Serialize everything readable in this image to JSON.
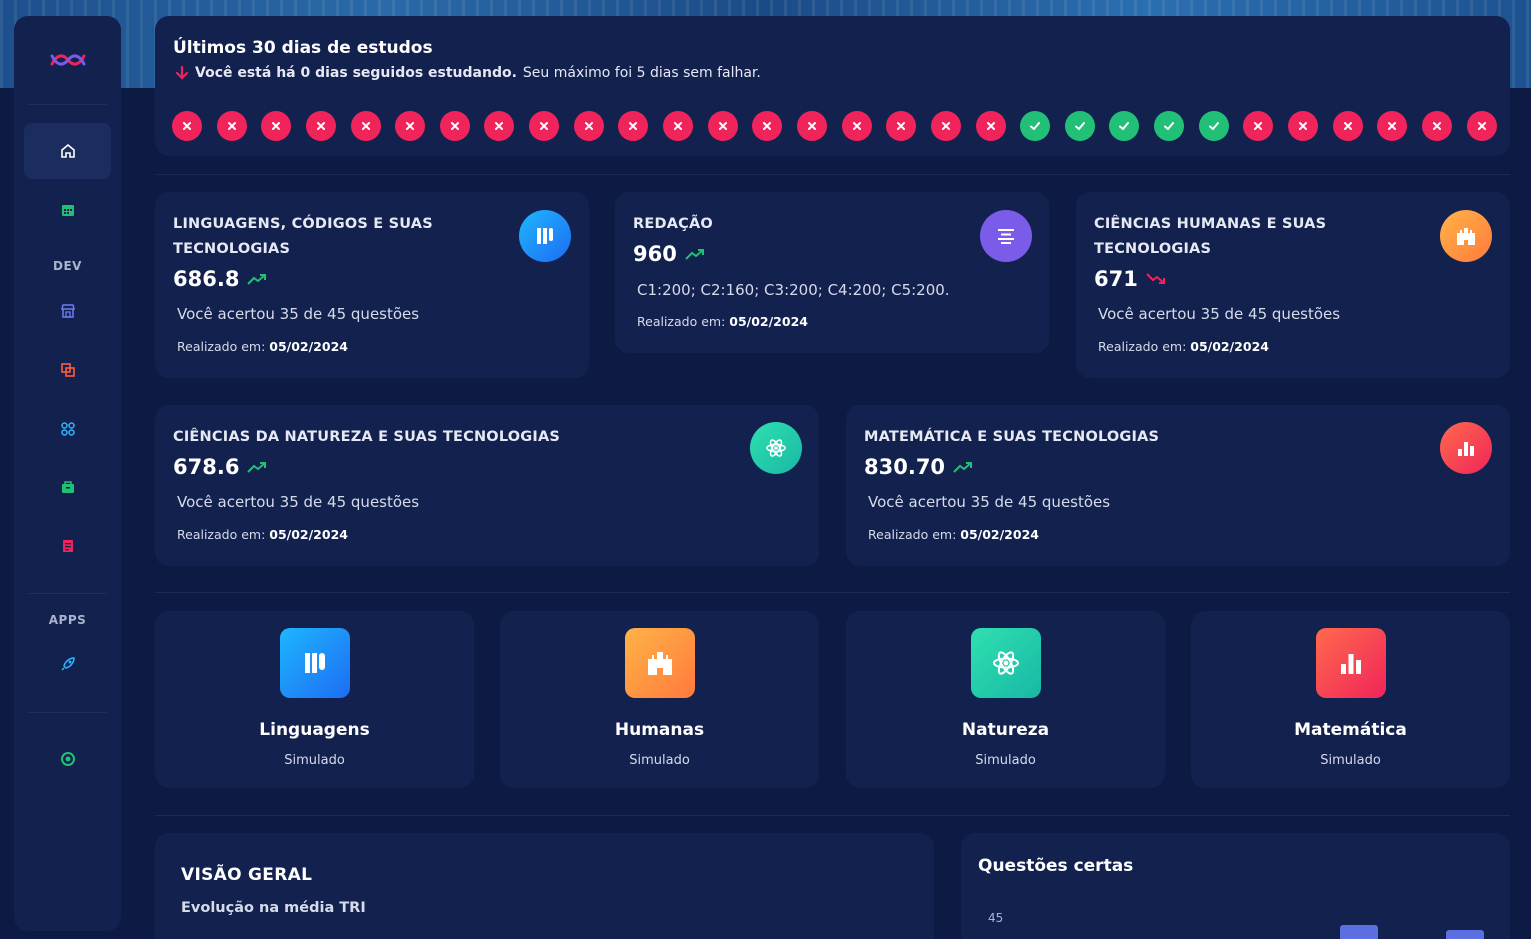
{
  "sidebar": {
    "sections": [
      "DEV",
      "APPS"
    ],
    "items": [
      {
        "icon": "home-icon",
        "active": true
      },
      {
        "icon": "calendar-icon"
      },
      {
        "icon": "store-icon"
      },
      {
        "icon": "copy-icon"
      },
      {
        "icon": "command-icon"
      },
      {
        "icon": "bag-icon"
      },
      {
        "icon": "notes-icon"
      },
      {
        "icon": "rocket-icon"
      },
      {
        "icon": "support-icon"
      }
    ]
  },
  "streak": {
    "title": "Últimos 30 dias de estudos",
    "bold_text": "Você está há 0 dias seguidos estudando.",
    "rest_text": "Seu máximo foi 5 dias sem falhar.",
    "days": [
      "miss",
      "miss",
      "miss",
      "miss",
      "miss",
      "miss",
      "miss",
      "miss",
      "miss",
      "miss",
      "miss",
      "miss",
      "miss",
      "miss",
      "miss",
      "miss",
      "miss",
      "miss",
      "miss",
      "hit",
      "hit",
      "hit",
      "hit",
      "hit",
      "miss",
      "miss",
      "miss",
      "miss",
      "miss",
      "miss"
    ]
  },
  "scores": [
    {
      "title": "LINGUAGENS, CÓDIGOS E SUAS TECNOLOGIAS",
      "score": "686.8",
      "trend": "up",
      "detail": "Você acertou 35 de 45 questões",
      "date_label": "Realizado em:",
      "date": "05/02/2024",
      "icon": "books-icon"
    },
    {
      "title": "REDAÇÃO",
      "score": "960",
      "trend": "up",
      "detail": "C1:200; C2:160; C3:200; C4:200; C5:200.",
      "date_label": "Realizado em:",
      "date": "05/02/2024",
      "icon": "align-center-icon"
    },
    {
      "title": "CIÊNCIAS HUMANAS E SUAS TECNOLOGIAS",
      "score": "671",
      "trend": "down",
      "detail": "Você acertou 35 de 45 questões",
      "date_label": "Realizado em:",
      "date": "05/02/2024",
      "icon": "castle-icon"
    },
    {
      "title": "CIÊNCIAS DA NATUREZA E SUAS TECNOLOGIAS",
      "score": "678.6",
      "trend": "up",
      "detail": "Você acertou 35 de 45 questões",
      "date_label": "Realizado em:",
      "date": "05/02/2024",
      "icon": "atom-icon"
    },
    {
      "title": "MATEMÁTICA E SUAS TECNOLOGIAS",
      "score": "830.70",
      "trend": "up",
      "detail": "Você acertou 35 de 45 questões",
      "date_label": "Realizado em:",
      "date": "05/02/2024",
      "icon": "bar-chart-icon"
    }
  ],
  "simulados": [
    {
      "name": "Linguagens",
      "sub": "Simulado",
      "icon": "books-icon"
    },
    {
      "name": "Humanas",
      "sub": "Simulado",
      "icon": "castle-icon"
    },
    {
      "name": "Natureza",
      "sub": "Simulado",
      "icon": "atom-icon"
    },
    {
      "name": "Matemática",
      "sub": "Simulado",
      "icon": "bar-chart-icon"
    }
  ],
  "overview": {
    "title": "VISÃO GERAL",
    "subtitle": "Evolução na média TRI"
  },
  "correct_questions": {
    "title": "Questões certas",
    "y_tick": "45"
  },
  "colors": {
    "background": "#0d1a44",
    "card": "#13214f",
    "miss": "#f0245a",
    "hit": "#22c077"
  }
}
